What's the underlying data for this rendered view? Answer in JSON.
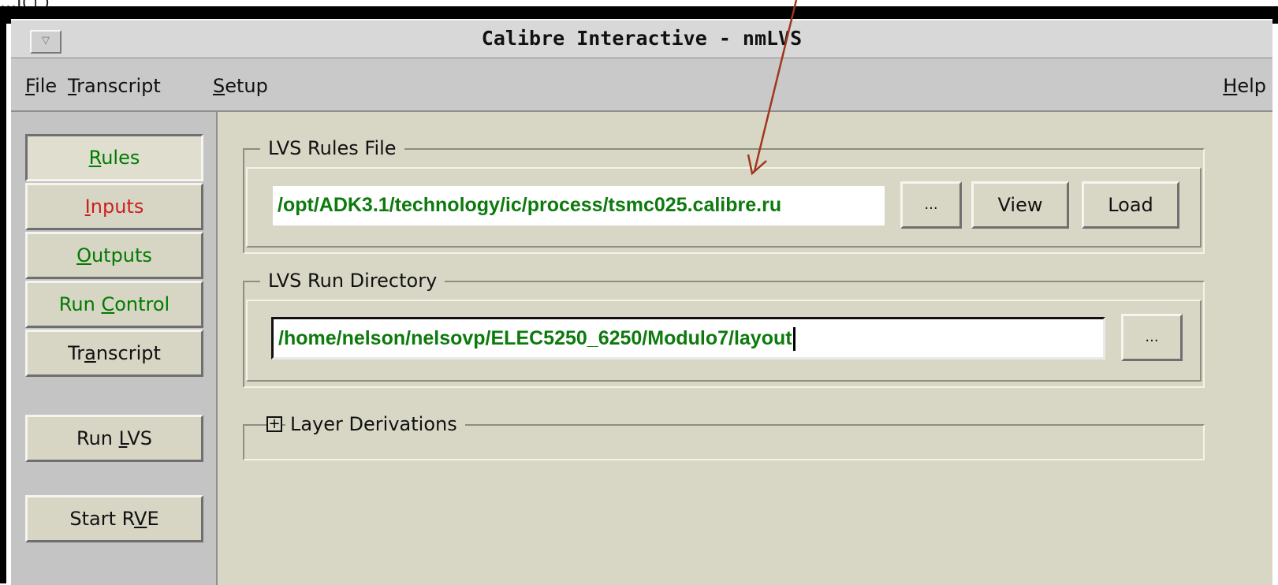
{
  "background_fragment": {
    "left_text": "...Ĩ(↑)"
  },
  "window": {
    "title": "Calibre Interactive - nmLVS"
  },
  "menu": {
    "file": {
      "ul": "F",
      "rest": "ile"
    },
    "transcript": {
      "ul": "T",
      "rest": "ranscript"
    },
    "setup": {
      "ul": "S",
      "rest": "etup"
    },
    "help": {
      "ul": "H",
      "rest": "elp"
    }
  },
  "sidebar": {
    "rules": {
      "ul": "R",
      "rest": "ules"
    },
    "inputs": {
      "ul": "I",
      "rest": "nputs"
    },
    "outputs": {
      "ul": "O",
      "rest": "utputs"
    },
    "run_control": {
      "pre": "Run ",
      "ul": "C",
      "rest": "ontrol"
    },
    "transcript": {
      "pre": "Tr",
      "ul": "a",
      "rest": "nscript"
    },
    "run_lvs": {
      "pre": "Run ",
      "ul": "L",
      "rest": "VS"
    },
    "start_rve": {
      "pre": "Start R",
      "ul": "V",
      "rest": "E"
    }
  },
  "rules_file": {
    "label": "LVS Rules File",
    "path": "/opt/ADK3.1/technology/ic/process/tsmc025.calibre.ru",
    "browse": "...",
    "view": "View",
    "load": "Load"
  },
  "run_directory": {
    "label": "LVS Run Directory",
    "path": "/home/nelson/nelsovp/ELEC5250_6250/Modulo7/layout",
    "browse": "..."
  },
  "layer_derivations": {
    "label": "Layer Derivations",
    "toggle": "+"
  },
  "colors": {
    "panel_background": "#d8d7c5",
    "tab_active_text": "#007a00",
    "tab_attention_text": "#cc1f1f",
    "path_text": "#0d7a0d",
    "annotation_arrow": "#a0361d"
  },
  "icons": [
    "window-menu-icon",
    "expand-plus-icon",
    "annotation-arrow"
  ]
}
